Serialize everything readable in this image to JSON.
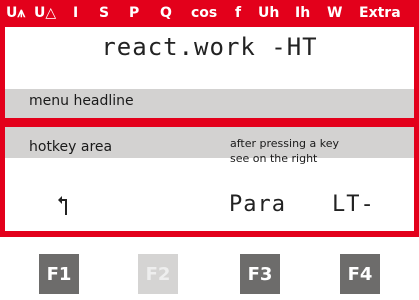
{
  "header": {
    "quantities": [
      "U⩚",
      "U△",
      "I",
      "S",
      "P",
      "Q",
      "cos",
      "f",
      "Uh",
      "Ih",
      "W",
      "Extra"
    ]
  },
  "display": {
    "title": "react.work -HT",
    "menu_headline_label": "menu headline",
    "hotkey_area_label": "hotkey area",
    "hotkey_note_line1": "after pressing a key",
    "hotkey_note_line2": "see on the right",
    "softkeys": {
      "f1_icon": "back-arrow-icon",
      "f3_label": "Para",
      "f4_label": "LT-"
    }
  },
  "keys": [
    {
      "label": "F1",
      "enabled": true
    },
    {
      "label": "F2",
      "enabled": false
    },
    {
      "label": "F3",
      "enabled": true
    },
    {
      "label": "F4",
      "enabled": true
    }
  ],
  "colors": {
    "frame": "#e3001b",
    "band": "#d3d2d1",
    "key": "#6d6c6b",
    "key_disabled": "#d5d4d3"
  }
}
